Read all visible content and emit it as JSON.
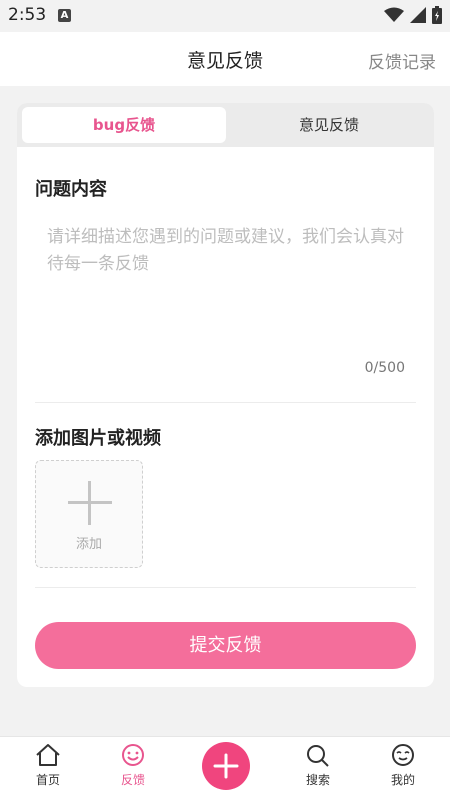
{
  "status": {
    "time": "2:53",
    "a_icon": "A"
  },
  "header": {
    "title": "意见反馈",
    "link": "反馈记录"
  },
  "tabs": [
    {
      "label": "bug反馈",
      "active": true
    },
    {
      "label": "意见反馈",
      "active": false
    }
  ],
  "content": {
    "title": "问题内容",
    "placeholder": "请详细描述您遇到的问题或建议，我们会认真对待每一条反馈",
    "counter": "0/500"
  },
  "upload": {
    "title": "添加图片或视频",
    "label": "添加"
  },
  "submit_label": "提交反馈",
  "nav": [
    {
      "label": "首页",
      "icon": "home-icon",
      "active": false
    },
    {
      "label": "反馈",
      "icon": "smiley-icon",
      "active": true
    },
    {
      "label": "",
      "icon": "plus-icon",
      "active": false
    },
    {
      "label": "搜索",
      "icon": "search-icon",
      "active": false
    },
    {
      "label": "我的",
      "icon": "face-icon",
      "active": false
    }
  ],
  "colors": {
    "accent": "#f0457e",
    "submit": "#f46e9b"
  }
}
